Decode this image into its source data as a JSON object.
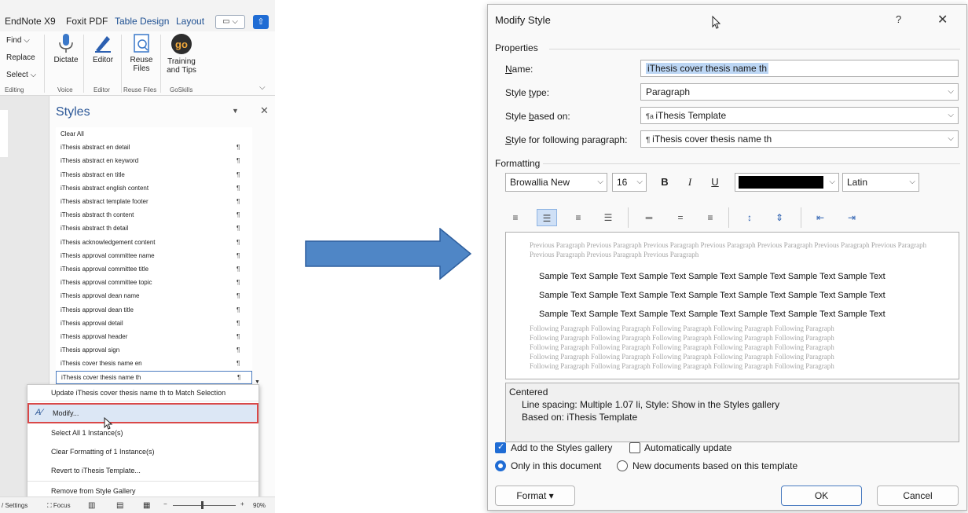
{
  "ribbon": {
    "tabs": [
      "EndNote X9",
      "Foxit PDF",
      "Table Design",
      "Layout"
    ],
    "editing_items": [
      "Find",
      "Replace",
      "Select"
    ],
    "buttons": {
      "dictate": "Dictate",
      "editor": "Editor",
      "reuse_files": [
        "Reuse",
        "Files"
      ],
      "training": [
        "Training",
        "and Tips"
      ]
    },
    "group_labels": [
      "Editing",
      "Voice",
      "Editor",
      "Reuse Files",
      "GoSkills"
    ]
  },
  "styles_pane": {
    "title": "Styles",
    "clear_all": "Clear All",
    "items": [
      "iThesis abstract en detail",
      "iThesis abstract en keyword",
      "iThesis abstract en title",
      "iThesis abstract english content",
      "iThesis abstract template footer",
      "iThesis abstract th content",
      "iThesis abstract th detail",
      "iThesis acknowledgement content",
      "iThesis approval committee name",
      "iThesis approval committee title",
      "iThesis approval committee topic",
      "iThesis approval dean name",
      "iThesis approval dean title",
      "iThesis approval detail",
      "iThesis approval header",
      "iThesis approval sign",
      "iThesis cover thesis name en",
      "iThesis cover thesis name th"
    ],
    "para_mark": "¶",
    "selected_index": 17
  },
  "context_menu": {
    "update": "Update iThesis cover thesis name th to Match Selection",
    "modify": "Modify...",
    "select_all": "Select All 1 Instance(s)",
    "clear_formatting": "Clear Formatting of 1 Instance(s)",
    "revert": "Revert to iThesis Template...",
    "remove": "Remove from Style Gallery"
  },
  "status_bar": {
    "settings": "Settings",
    "focus": "Focus",
    "zoom": "90%"
  },
  "dialog": {
    "title": "Modify Style",
    "help": "?",
    "close": "✕",
    "properties_label": "Properties",
    "name_label": "Name:",
    "name_value": "iThesis cover thesis name th",
    "style_type_label": "Style type:",
    "style_type_value": "Paragraph",
    "based_on_label": "Style based on:",
    "based_on_value": "iThesis Template",
    "following_label": "Style for following paragraph:",
    "following_value": "iThesis cover thesis name th",
    "formatting_label": "Formatting",
    "font": "Browallia New",
    "size": "16",
    "bold": "B",
    "italic": "I",
    "underline": "U",
    "font_color": "#000000",
    "script": "Latin",
    "preview": {
      "previous": "Previous Paragraph Previous Paragraph Previous Paragraph Previous Paragraph Previous Paragraph Previous Paragraph Previous Paragraph Previous Paragraph Previous Paragraph Previous Paragraph",
      "sample_lines": [
        "Sample Text Sample Text Sample Text Sample Text Sample Text Sample Text Sample Text",
        "Sample Text Sample Text Sample Text Sample Text Sample Text Sample Text Sample Text",
        "Sample Text Sample Text Sample Text Sample Text Sample Text Sample Text Sample Text"
      ],
      "following_lines": [
        "Following Paragraph Following Paragraph Following Paragraph Following Paragraph Following Paragraph",
        "Following Paragraph Following Paragraph Following Paragraph Following Paragraph Following Paragraph",
        "Following Paragraph Following Paragraph Following Paragraph Following Paragraph Following Paragraph",
        "Following Paragraph Following Paragraph Following Paragraph Following Paragraph Following Paragraph",
        "Following Paragraph Following Paragraph Following Paragraph Following Paragraph Following Paragraph"
      ]
    },
    "description": {
      "line1": "Centered",
      "line2": "Line spacing:  Multiple 1.07 li, Style: Show in the Styles gallery",
      "line3": "Based on: iThesis Template"
    },
    "add_to_gallery": "Add to the Styles gallery",
    "auto_update": "Automatically update",
    "only_this_doc": "Only in this document",
    "new_docs": "New documents based on this template",
    "format_btn": "Format ▾",
    "ok": "OK",
    "cancel": "Cancel"
  },
  "colors": {
    "accent": "#1f6cd4",
    "arrow_fill": "#4f86c6",
    "arrow_stroke": "#2e5f9e",
    "highlight_border": "#d94848"
  }
}
